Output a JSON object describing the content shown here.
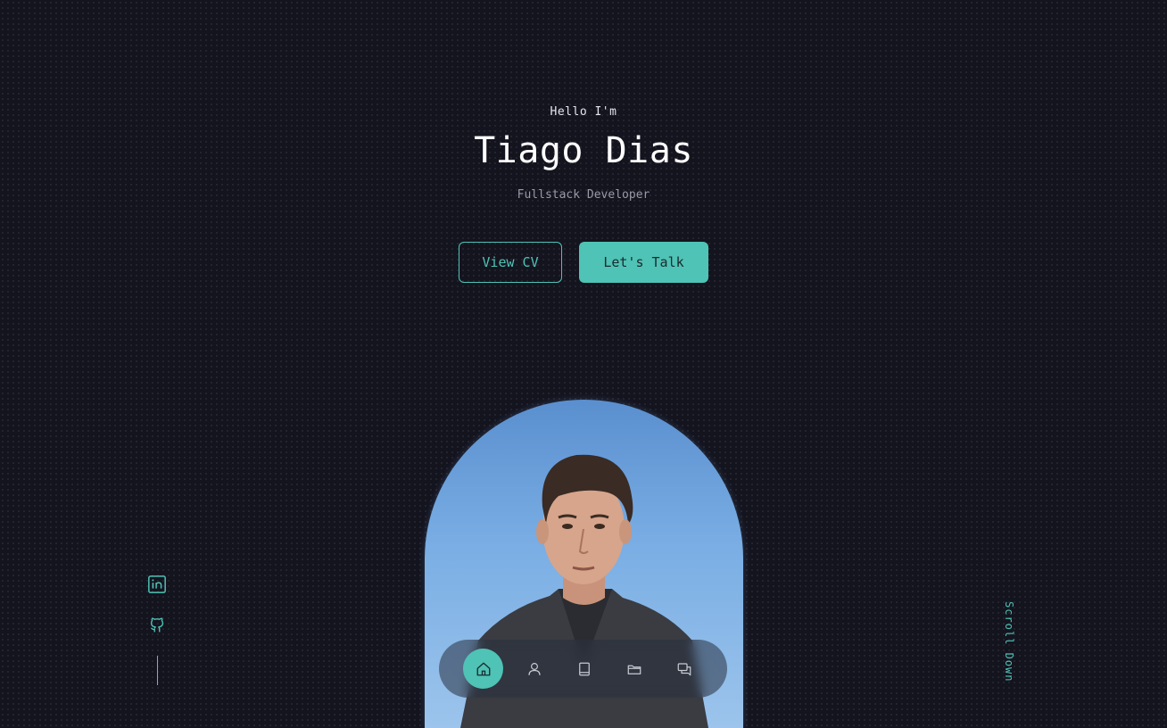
{
  "hero": {
    "greeting": "Hello I'm",
    "name": "Tiago Dias",
    "role": "Fullstack Developer"
  },
  "buttons": {
    "view_cv": "View CV",
    "lets_talk": "Let's Talk"
  },
  "nav": {
    "items": [
      {
        "icon": "home-icon",
        "active": true
      },
      {
        "icon": "user-icon",
        "active": false
      },
      {
        "icon": "book-icon",
        "active": false
      },
      {
        "icon": "folder-icon",
        "active": false
      },
      {
        "icon": "chat-icon",
        "active": false
      }
    ]
  },
  "social": {
    "items": [
      {
        "icon": "linkedin-icon"
      },
      {
        "icon": "github-icon"
      }
    ]
  },
  "scroll": {
    "label": "Scroll Down"
  },
  "colors": {
    "background": "#14141f",
    "accent": "#4fc3b5",
    "text": "#ffffff",
    "muted": "#9a9aa8"
  }
}
